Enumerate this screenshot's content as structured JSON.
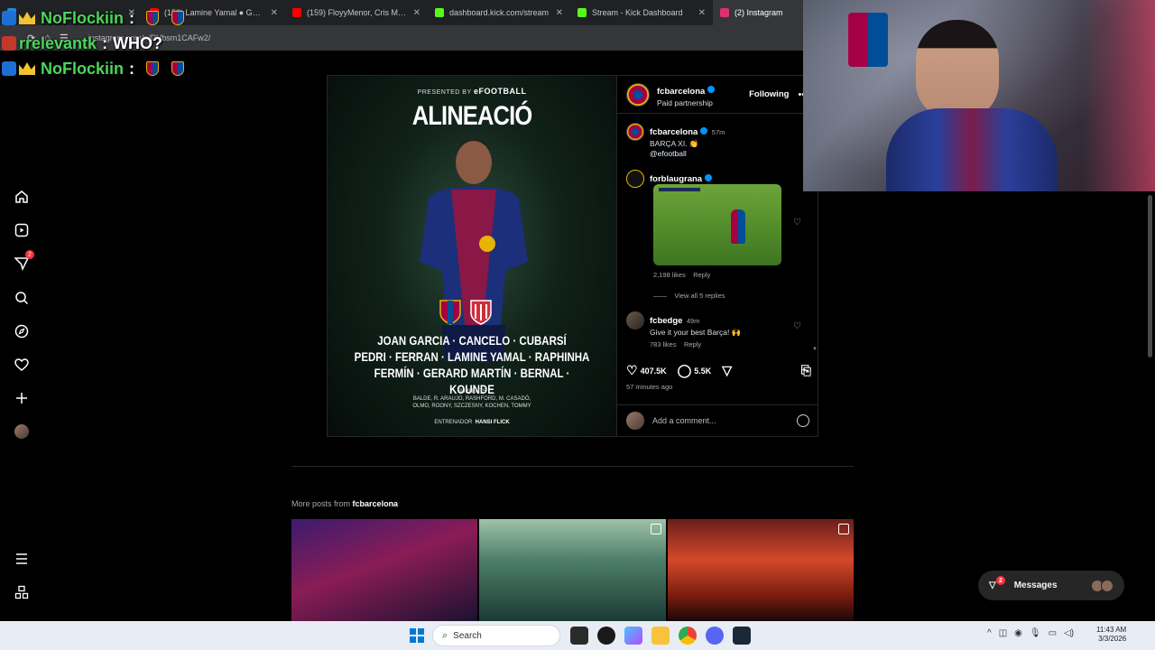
{
  "browser": {
    "tabs": [
      {
        "label": "",
        "icon_color": "#1e88e5",
        "active": false
      },
      {
        "label": "(159) Lamine Yamal ● GOZALO",
        "icon_color": "#ff0000",
        "active": false
      },
      {
        "label": "(159) FloyyMenor, Cris MJ - Gat",
        "icon_color": "#ff0000",
        "active": false
      },
      {
        "label": "dashboard.kick.com/stream",
        "icon_color": "#53fc18",
        "active": false
      },
      {
        "label": "Stream - Kick Dashboard",
        "icon_color": "#53fc18",
        "active": false
      },
      {
        "label": "(2) Instagram",
        "icon_color": "#e1306c",
        "active": true
      }
    ],
    "url": "instagram.com/p/DVbsm1CAFw2/"
  },
  "chat": [
    {
      "user": "NoFlockiin",
      "message": "",
      "emotes": 2
    },
    {
      "user": "rrelevantk",
      "message": "WHO?",
      "emotes": 0
    },
    {
      "user": "NoFlockiin",
      "message": "",
      "emotes": 2
    }
  ],
  "nav": {
    "notification_count": "2",
    "icons": [
      "home-icon",
      "reels-icon",
      "messages-icon",
      "search-icon",
      "explore-icon",
      "heart-icon",
      "create-icon",
      "profile-avatar"
    ],
    "bottom_icons": [
      "menu-icon",
      "also-from-meta-icon"
    ]
  },
  "post": {
    "image": {
      "presented_by": "PRESENTED BY",
      "sponsor": "eFOOTBALL",
      "headline": "ALINEACIÓ",
      "lineup_line1": "JOAN GARCIA · CANCELO · CUBARSÍ",
      "lineup_line2": "PEDRI · FERRAN · LAMINE YAMAL · RAPHINHA",
      "lineup_line3": "FERMÍN · GERARD MARTÍN · BERNAL · KOUNDE",
      "subs_label": "SUPLENTS",
      "subs_line1": "BALDE, R. ARAUJO, RASHFORD, M. CASADÓ,",
      "subs_line2": "OLMO, ROONY, SZCZESNY, KOCHEN, TOMMY",
      "coach_label": "ENTRENADOR",
      "coach_name": "HANSI FLICK"
    },
    "header": {
      "username": "fcbarcelona",
      "subtitle": "Paid partnership",
      "follow_state": "Following",
      "more": "•••"
    },
    "caption": {
      "username": "fcbarcelona",
      "time": "57m",
      "text": "BARÇA XI. 👏",
      "mention": "@efootball"
    },
    "comments": [
      {
        "username": "forblaugrana",
        "likes": "2,198 likes",
        "reply": "Reply",
        "view_replies": "View all 5 replies"
      },
      {
        "username": "fcbedge",
        "time": "49m",
        "text": "Give it your best Barça! 🙌",
        "likes": "783 likes",
        "reply": "Reply"
      }
    ],
    "likes_count": "407.5K",
    "comments_count": "5.5K",
    "time_ago": "57 minutes ago",
    "add_comment_placeholder": "Add a comment..."
  },
  "more_posts": {
    "prefix": "More posts from",
    "username": "fcbarcelona"
  },
  "messages_pill": {
    "label": "Messages",
    "count": "2"
  },
  "taskbar": {
    "search_label": "Search",
    "time": "11:43 AM",
    "date": "3/3/2026"
  },
  "colors": {
    "chat_username": "#4bd65b",
    "instagram_blue": "#0095f6",
    "notification_red": "#ff3040",
    "barca_red": "#a50044",
    "barca_blue": "#004d98"
  }
}
